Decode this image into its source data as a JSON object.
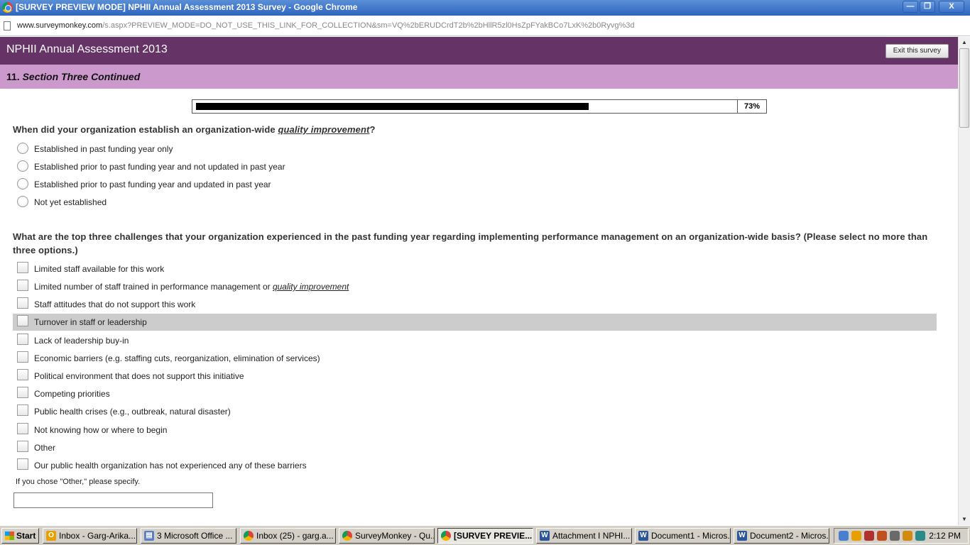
{
  "window": {
    "title": "[SURVEY PREVIEW MODE] NPHII Annual Assessment 2013 Survey - Google Chrome",
    "minimize": "—",
    "maximize": "❐",
    "close": "X"
  },
  "address": {
    "host": "www.surveymonkey.com",
    "path": "/s.aspx?PREVIEW_MODE=DO_NOT_USE_THIS_LINK_FOR_COLLECTION&sm=VQ%2bERUDCrdT2b%2bHllR5zl0HsZpFYakBCo7LxK%2b0Ryvg%3d"
  },
  "survey": {
    "title": "NPHII Annual Assessment 2013",
    "exit_label": "Exit this survey",
    "section_number": "11.",
    "section_name": "Section Three Continued",
    "progress_percent": 73,
    "progress_label": "73%"
  },
  "q1": {
    "text_before": "When did your organization establish an organization-wide ",
    "text_emph": "quality improvement",
    "text_after": "?",
    "options": [
      "Established in past funding year only",
      "Established prior to past funding year and not updated in past year",
      "Established prior to past funding year and updated in past year",
      "Not yet established"
    ]
  },
  "q2": {
    "text": "What are the top three challenges that your organization experienced in the past funding year regarding implementing performance management on an organization-wide basis? (Please select no more than three options.)",
    "options": [
      "Limited staff available for this work",
      "Limited number of staff trained in performance management or ",
      "Staff attitudes that do not support this work",
      "Turnover in staff or leadership",
      "Lack of leadership buy-in",
      "Economic barriers (e.g. staffing cuts, reorganization, elimination of services)",
      "Political environment that does not support this initiative",
      "Competing priorities",
      "Public health crises (e.g., outbreak, natural disaster)",
      "Not knowing how or where to begin",
      "Other",
      "Our public health organization has not experienced any of these barriers"
    ],
    "option2_emph": "quality improvement",
    "other_prompt": "If you chose \"Other,\" please specify.",
    "other_value": ""
  },
  "taskbar": {
    "start": "Start",
    "tasks": [
      "Inbox - Garg-Arika...",
      "3 Microsoft Office ...",
      "Inbox (25) - garg.a...",
      "SurveyMonkey - Qu...",
      "[SURVEY PREVIE...",
      "Attachment I  NPHI...",
      "Document1 - Micros...",
      "Document2 - Micros..."
    ],
    "clock": "2:12 PM"
  },
  "colors": {
    "header": "#663366",
    "section": "#cc99cc",
    "highlight_row": "#cccccc"
  }
}
